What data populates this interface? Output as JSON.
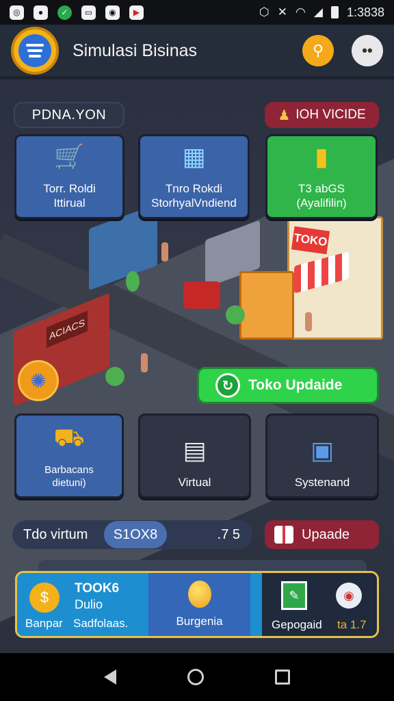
{
  "status_bar": {
    "time": "1:3838",
    "left_icons": [
      "camera-icon",
      "record-icon",
      "shield-icon",
      "gallery-icon",
      "media-icon",
      "youtube-icon"
    ]
  },
  "header": {
    "title": "Simulasi Bisinas"
  },
  "top_chips": {
    "left": "PDNA.YON",
    "right": "IOH VICIDE"
  },
  "top_cards": [
    {
      "line1": "Torr. Roldi",
      "line2": "Ittirual",
      "icon": "cart-icon"
    },
    {
      "line1": "Tnro Rokdi",
      "line2": "StorhyalVndiend",
      "icon": "boxes-icon"
    },
    {
      "line1": "T3 abGS",
      "line2": "(Ayalifilin)",
      "icon": "bin-icon"
    }
  ],
  "scene": {
    "toko_sign": "TOKO",
    "stall_sign": "ACIACS"
  },
  "update_button": "Toko Updaide",
  "bottom_cards": [
    {
      "line1": "Barbacans",
      "line2": "dietuni)",
      "icon": "truck-icon"
    },
    {
      "line1": "Virtual",
      "icon": "shelves-icon"
    },
    {
      "line1": "Systenand",
      "icon": "crates-icon"
    }
  ],
  "stats": {
    "label": "Tdo virtum",
    "pill": "S1OX8",
    "value": ".7 5"
  },
  "upgrade_button": "Upaade",
  "dashboard": {
    "left_value1": "TOOK6",
    "left_value2": "Dulio",
    "left_label1": "Banpar",
    "left_label2": "Sadfolaas.",
    "mid_label": "Burgenia",
    "right_label": "Gepogaid",
    "right_value": "ta 1.7"
  },
  "colors": {
    "accent_orange": "#f4a91a",
    "card_blue": "#3b63a8",
    "card_green": "#2fb54a",
    "chip_maroon": "#8e2436",
    "dash_blue": "#1d8fd1"
  }
}
